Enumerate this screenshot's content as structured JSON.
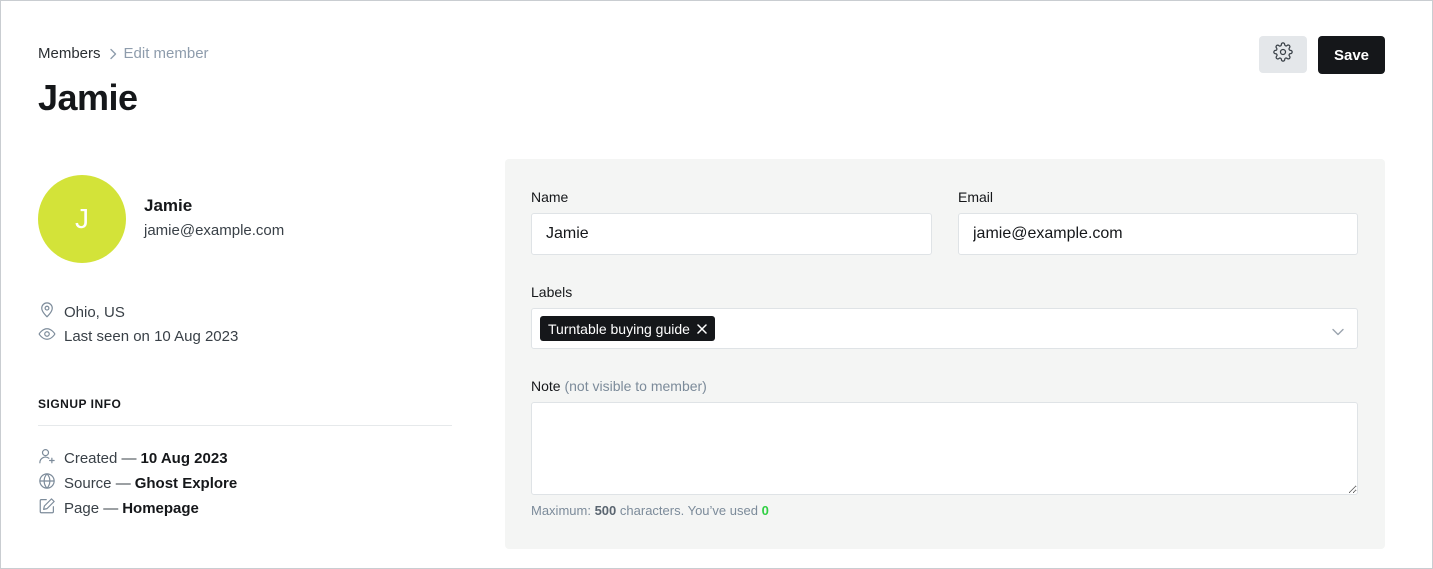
{
  "breadcrumb": {
    "parent": "Members",
    "current": "Edit member"
  },
  "page": {
    "title": "Jamie"
  },
  "toolbar": {
    "save_label": "Save"
  },
  "member": {
    "avatar_initial": "J",
    "avatar_color": "#d3e339",
    "name": "Jamie",
    "email": "jamie@example.com",
    "location": "Ohio, US",
    "last_seen": "Last seen on 10 Aug 2023"
  },
  "signup_info": {
    "heading": "SIGNUP INFO",
    "created_label": "Created —",
    "created_value": "10 Aug 2023",
    "source_label": "Source —",
    "source_value": "Ghost Explore",
    "page_label": "Page —",
    "page_value": "Homepage"
  },
  "form": {
    "name_label": "Name",
    "name_value": "Jamie",
    "email_label": "Email",
    "email_value": "jamie@example.com",
    "labels_label": "Labels",
    "labels": [
      "Turntable buying guide"
    ],
    "note_label": "Note",
    "note_hint": "(not visible to member)",
    "note_value": "",
    "char_count_prefix": "Maximum:",
    "char_max": "500",
    "char_count_mid": "characters. You’ve used",
    "char_used": "0"
  },
  "colors": {
    "accent_dark": "#15171a",
    "panel_bg": "#f4f5f4",
    "success_green": "#30cf43"
  }
}
